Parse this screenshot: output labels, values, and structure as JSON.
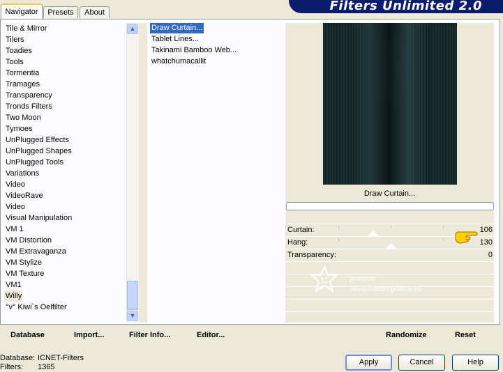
{
  "tabs": [
    {
      "label": "Navigator",
      "active": true
    },
    {
      "label": "Presets",
      "active": false
    },
    {
      "label": "About",
      "active": false
    }
  ],
  "banner_title": "Filters Unlimited 2.0",
  "categories": [
    "Tile & Mirror",
    "Tilers",
    "Toadies",
    "Tools",
    "Tormentia",
    "Tramages",
    "Transparency",
    "Tronds Filters",
    "Two Moon",
    "Tymoes",
    "UnPlugged Effects",
    "UnPlugged Shapes",
    "UnPlugged Tools",
    "Variations",
    "Video",
    "VideoRave",
    "Video",
    "Visual Manipulation",
    "VM 1",
    "VM Distortion",
    "VM Extravaganza",
    "VM Stylize",
    "VM Texture",
    "VM1",
    "Willy",
    "°v° Kiwi`s Oelfilter"
  ],
  "selected_category": "Willy",
  "filters": [
    "Draw Curtain...",
    "Tablet Lines...",
    "Takinami Bamboo Web...",
    "whatchumacallit"
  ],
  "selected_filter": "Draw Curtain...",
  "preview_filter_name": "Draw Curtain...",
  "controls": [
    {
      "label": "Curtain:",
      "value": "106"
    },
    {
      "label": "Hang:",
      "value": "130"
    },
    {
      "label": "Transparency:",
      "value": "0"
    }
  ],
  "watermark": {
    "line1": "pinuccia",
    "line2": "www.maidiregrafica.eu"
  },
  "toolbar": {
    "database": "Database",
    "import": "Import...",
    "filter_info": "Filter Info...",
    "editor": "Editor...",
    "randomize": "Randomize",
    "reset": "Reset"
  },
  "status": {
    "database_label": "Database:",
    "database_value": "ICNET-Filters",
    "filters_label": "Filters:",
    "filters_value": "1365"
  },
  "buttons": {
    "apply": "Apply",
    "cancel": "Cancel",
    "help": "Help"
  },
  "colors": {
    "accent": "#316ac5",
    "banner": "#0b1c6e",
    "tab_highlight": "#ffc83c"
  }
}
